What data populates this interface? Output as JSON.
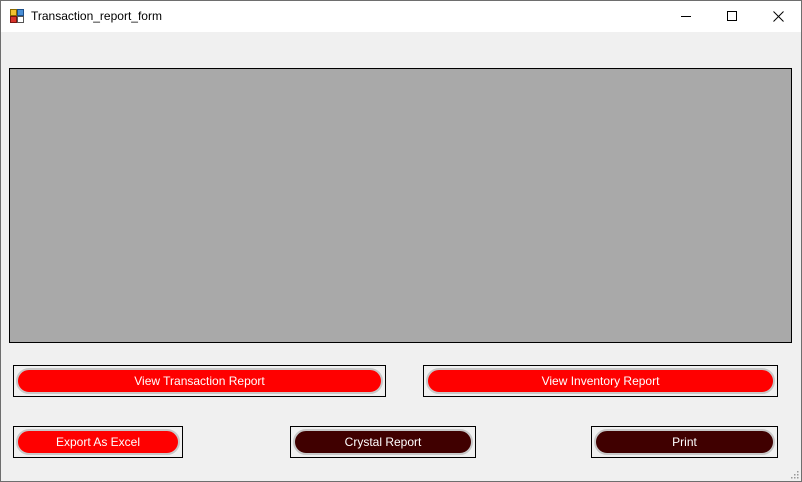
{
  "window": {
    "title": "Transaction_report_form"
  },
  "buttons": {
    "view_transaction": "View Transaction Report",
    "view_inventory": "View Inventory Report",
    "export_excel": "Export As Excel",
    "crystal_report": "Crystal Report",
    "print": "Print"
  },
  "colors": {
    "red_button": "#ff0000",
    "dark_button": "#400000",
    "viewer_background": "#a9a9a9",
    "form_background": "#f0f0f0"
  },
  "icons": {
    "app": "app-icon",
    "minimize": "minimize-icon",
    "maximize": "maximize-icon",
    "close": "close-icon",
    "resize": "resize-grip-icon"
  }
}
